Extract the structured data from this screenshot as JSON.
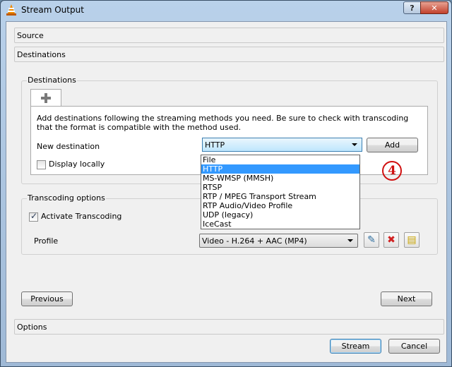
{
  "window": {
    "title": "Stream Output",
    "help_label": "?",
    "close_label": "✕"
  },
  "sections": {
    "source": "Source",
    "destinations": "Destinations",
    "options": "Options"
  },
  "destinations": {
    "group_label": "Destinations",
    "add_tab_icon": "plus-icon",
    "help_text": "Add destinations following the streaming methods you need. Be sure to check with transcoding that the format is compatible with the method used.",
    "new_destination_label": "New destination",
    "selected_method": "HTTP",
    "add_button": "Add",
    "display_locally_label": "Display locally",
    "display_locally_checked": false,
    "method_options": [
      "File",
      "HTTP",
      "MS-WMSP (MMSH)",
      "RTSP",
      "RTP / MPEG Transport Stream",
      "RTP Audio/Video Profile",
      "UDP (legacy)",
      "IceCast"
    ],
    "highlighted_index": 1
  },
  "transcoding": {
    "group_label": "Transcoding options",
    "activate_label": "Activate Transcoding",
    "activate_checked": true,
    "profile_label": "Profile",
    "profile_value": "Video - H.264 + AAC (MP4)"
  },
  "navigation": {
    "previous": "Previous",
    "next": "Next",
    "stream": "Stream",
    "cancel": "Cancel"
  },
  "annotation": {
    "marker": "4",
    "color": "#d01010"
  },
  "colors": {
    "selection": "#3399ff",
    "title_bar": "#b9d1ea"
  }
}
